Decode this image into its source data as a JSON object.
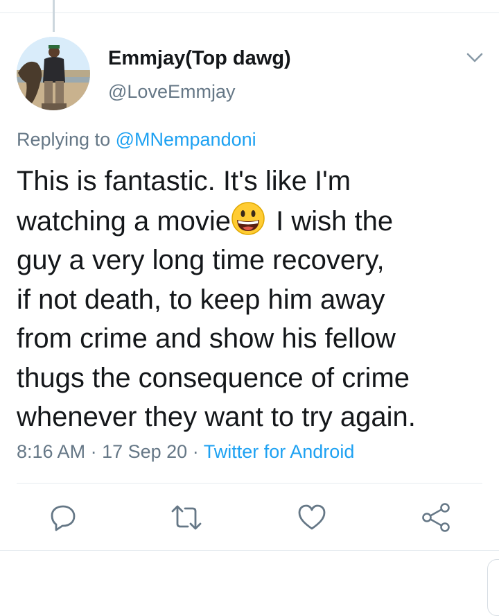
{
  "tweet": {
    "author": {
      "display_name": "Emmjay(Top dawg)",
      "handle": "@LoveEmmjay",
      "avatar_icon": "user-photo"
    },
    "reply": {
      "prefix": "Replying to",
      "to": "@MNempandoni"
    },
    "text_lines": [
      "This is fantastic. It's like I'm",
      "watching a movie",
      "I wish the",
      "guy a very long time recovery,",
      "if not death, to keep him away",
      "from crime and show his fellow",
      "thugs the consequence of crime",
      "whenever they want to try again."
    ],
    "emoji": "grinning-face-emoji",
    "meta": {
      "time": "8:16 AM",
      "date": "17 Sep 20",
      "separator": "·",
      "source": "Twitter for Android"
    },
    "actions": [
      {
        "icon": "reply-icon"
      },
      {
        "icon": "retweet-icon"
      },
      {
        "icon": "like-icon"
      },
      {
        "icon": "share-icon"
      }
    ]
  },
  "colors": {
    "accent": "#1da1f2",
    "secondary_text": "#657786",
    "primary_text": "#14171a",
    "divider": "#e6ecf0"
  }
}
